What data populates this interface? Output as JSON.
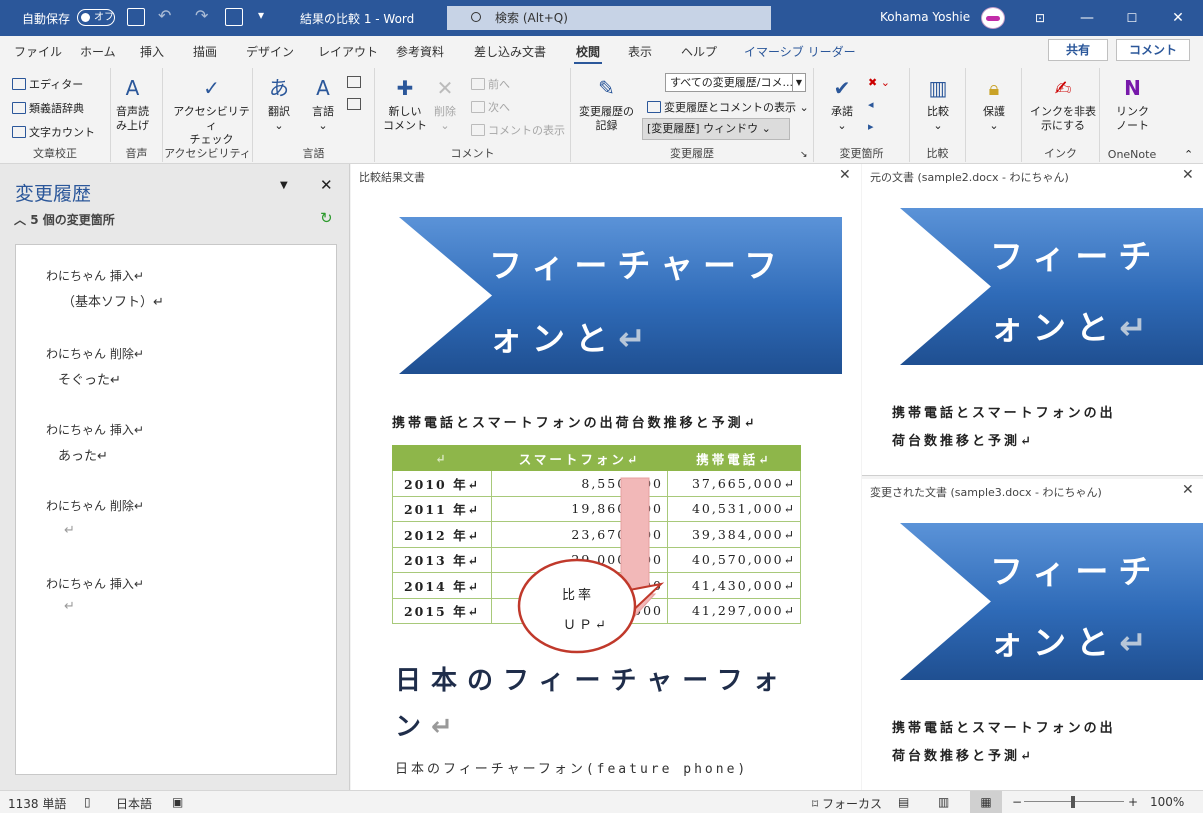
{
  "titlebar": {
    "autosave_label": "自動保存",
    "autosave_state": "オフ",
    "doc_title": "結果の比較 1  -  Word",
    "search_placeholder": "検索 (Alt+Q)",
    "user_name": "Kohama Yoshie"
  },
  "tabs": [
    "ファイル",
    "ホーム",
    "挿入",
    "描画",
    "デザイン",
    "レイアウト",
    "参考資料",
    "差し込み文書",
    "校閲",
    "表示",
    "ヘルプ",
    "イマーシブ リーダー"
  ],
  "active_tab": "校閲",
  "share_label": "共有",
  "comment_label": "コメント",
  "ribbon": {
    "proofing": {
      "items": [
        "エディター",
        "類義語辞典",
        "文字カウント"
      ],
      "label": "文章校正"
    },
    "speech": {
      "button": "音声読\nみ上げ",
      "label": "音声"
    },
    "accessibility": {
      "button": "アクセシビリティ\nチェック",
      "label": "アクセシビリティ"
    },
    "language": {
      "translate": "翻訳",
      "lang": "言語",
      "label": "言語"
    },
    "comments": {
      "new": "新しい\nコメント",
      "delete": "削除",
      "prev": "前へ",
      "next": "次へ",
      "show": "コメントの表示",
      "label": "コメント"
    },
    "tracking": {
      "record": "変更履歴の\n記録",
      "select_value": "すべての変更履歴/コメ...",
      "show_markup": "変更履歴とコメントの表示",
      "pane": "[変更履歴] ウィンドウ",
      "label": "変更履歴"
    },
    "changes": {
      "accept": "承諾",
      "label": "変更箇所"
    },
    "compare": {
      "button": "比較",
      "label": "比較"
    },
    "protect": {
      "button": "保護"
    },
    "ink": {
      "button": "インクを非表\n示にする",
      "label": "インク"
    },
    "onenote": {
      "button": "リンク\nノート",
      "label": "OneNote"
    }
  },
  "revisions_pane": {
    "title": "変更履歴",
    "count": "5 個の変更箇所",
    "items": [
      {
        "author": "わにちゃん 挿入↵",
        "content": "（基本ソフト）↵"
      },
      {
        "author": "わにちゃん 削除↵",
        "content": "そぐった↵"
      },
      {
        "author": "わにちゃん 挿入↵",
        "content": "あった↵"
      },
      {
        "author": "わにちゃん 削除↵",
        "content": "↵"
      },
      {
        "author": "わにちゃん 挿入↵",
        "content": "↵"
      }
    ]
  },
  "compared_doc": {
    "label": "比較結果文書",
    "banner_line1": "フィーチャーフ",
    "banner_line2": "ォンと",
    "subtitle": "携帯電話とスマートフォンの出荷台数推移と予測↵",
    "table": {
      "headers": [
        "↵",
        "スマートフォン↵",
        "携帯電話↵"
      ],
      "rows": [
        [
          "2010 年↵",
          "8,550,000",
          "37,665,000↵"
        ],
        [
          "2011 年↵",
          "19,860,000",
          "40,531,000↵"
        ],
        [
          "2012 年↵",
          "23,670,000",
          "39,384,000↵"
        ],
        [
          "2013 年↵",
          "29,000,000",
          "40,570,000↵"
        ],
        [
          "2014 年↵",
          "30,100,000",
          "41,430,000↵"
        ],
        [
          "2015 年↵",
          "32,600,000",
          "41,297,000↵"
        ]
      ]
    },
    "callout_line1": "比率",
    "callout_line2": "ＵＰ↵",
    "heading_line1": "日本のフィーチャーフォ",
    "heading_line2": "ン",
    "body_text": "日本のフィーチャーフォン(feature phone)"
  },
  "original_doc": {
    "label": "元の文書 (sample2.docx - わにちゃん)",
    "banner_line1": "フィーチ",
    "banner_line2": "ォンと",
    "subtitle_line1": "携帯電話とスマートフォンの出",
    "subtitle_line2": "荷台数推移と予測↵"
  },
  "revised_doc": {
    "label": "変更された文書 (sample3.docx - わにちゃん)",
    "banner_line1": "フィーチ",
    "banner_line2": "ォンと",
    "subtitle_line1": "携帯電話とスマートフォンの出",
    "subtitle_line2": "荷台数推移と予測↵"
  },
  "statusbar": {
    "words": "1138 単語",
    "language": "日本語",
    "focus": "フォーカス",
    "zoom": "100%"
  },
  "colors": {
    "accent": "#2b579a",
    "table_header": "#8eb64a",
    "banner": "#2f6bb8",
    "callout_fill": "#f2b8b8"
  }
}
